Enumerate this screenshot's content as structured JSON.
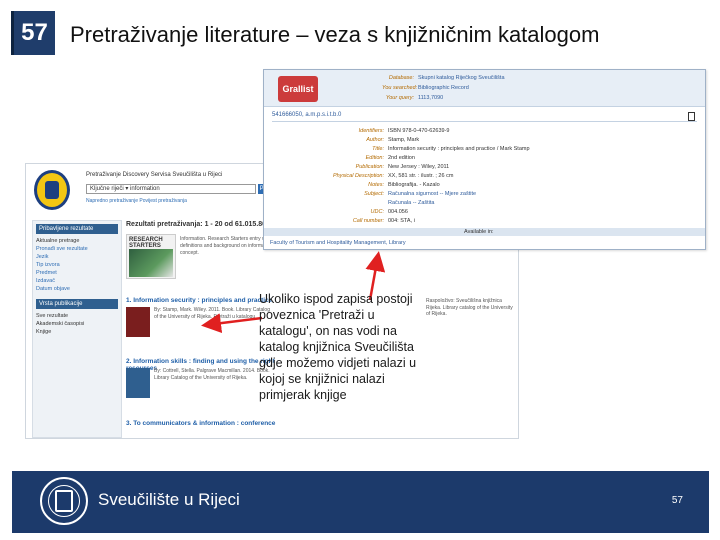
{
  "slide": {
    "number": "57",
    "title": "Pretraživanje literature – veza s knjižničnim katalogom",
    "page_number": "57"
  },
  "callout": {
    "text": "Ukoliko ispod zapisa postoji poveznica 'Pretraži u katalogu', on nas vodi na katalog knjižnica Sveučilišta gdje možemo vidjeti nalazi u kojoj se knjižnici nalazi primjerak knjige"
  },
  "footer": {
    "institution": "Sveučilište u Rijeci"
  },
  "catalog_record": {
    "logo": "Grallist",
    "header": [
      {
        "label": "Database:",
        "value": "Skupni katalog Riječkog Sveučilišta"
      },
      {
        "label": "You searched:",
        "value": "Bibliographic Record"
      },
      {
        "label": "Your query:",
        "value": "1113,7090"
      }
    ],
    "record_id": "541666050, a.m.p.s.i.t.b.0",
    "fields": [
      {
        "label": "Identifiers:",
        "value": "ISBN 978-0-470-62639-9"
      },
      {
        "label": "Author:",
        "value": "Stamp, Mark"
      },
      {
        "label": "Title:",
        "value": "Information security : principles and practice / Mark Stamp"
      },
      {
        "label": "Edition:",
        "value": "2nd edition"
      },
      {
        "label": "Publication:",
        "value": "New Jersey : Wiley, 2011"
      },
      {
        "label": "Physical Description:",
        "value": "XX, 581 str. : ilustr. ; 26 cm"
      },
      {
        "label": "Notes:",
        "value": "Bibliografija. - Kazalo"
      },
      {
        "label": "Subject:",
        "value": "Računalna sigurnost -- Mjere zaštite"
      },
      {
        "label": "",
        "value": "Računala -- Zaštita"
      },
      {
        "label": "UDC:",
        "value": "004.056"
      },
      {
        "label": "Call number:",
        "value": "004: STA, i"
      }
    ],
    "available_in": "Available in:",
    "library": "Faculty of Tourism and Hospitality Management, Library"
  },
  "search_page": {
    "top_line": "Pretraživanje Discovery Servisa Sveučilišta u Rijeci",
    "search_value": "Ključne riječi  ▾  information",
    "search_button": "Pretraži",
    "links": "Napredno pretraživanje   Povijest pretraživanja",
    "left_panel": {
      "header": "Pribavljene rezultate",
      "items": [
        "Aktualne pretrage",
        "Pronađi sve rezultate",
        "Jezik",
        "Tip izvora",
        "Predmet",
        "Izdavač",
        "Datum objave"
      ],
      "header2": "Vrsta publikacije",
      "items2": [
        "Sve rezultate",
        "Akademski časopisi",
        "Knjige"
      ]
    },
    "results_header": "Rezultati pretraživanja: 1 - 20 od 61.015.867",
    "research_starters": "RESEARCH STARTERS",
    "rs_text": "Information. Research Starters entry with definitions and background on information as a concept.",
    "items": [
      {
        "title": "1. Information security : principles and practice",
        "meta": "By: Stamp, Mark. Wiley. 2011. Book. Library Catalog of the University of Rijeka. Pretraži u katalogu"
      },
      {
        "title": "2. Information skills : finding and using the right resources",
        "meta": "By: Cottrell, Stella. Palgrave Macmillan. 2014. Book. Library Catalog of the University of Rijeka."
      },
      {
        "title": "3. To communicators & information : conference",
        "meta": "Proceedings. Library Catalog of the University of Rijeka."
      }
    ],
    "right_text": "Raspoloživo: Sveučilišna knjižnica Rijeka. Library catalog of the University of Rijeka."
  }
}
